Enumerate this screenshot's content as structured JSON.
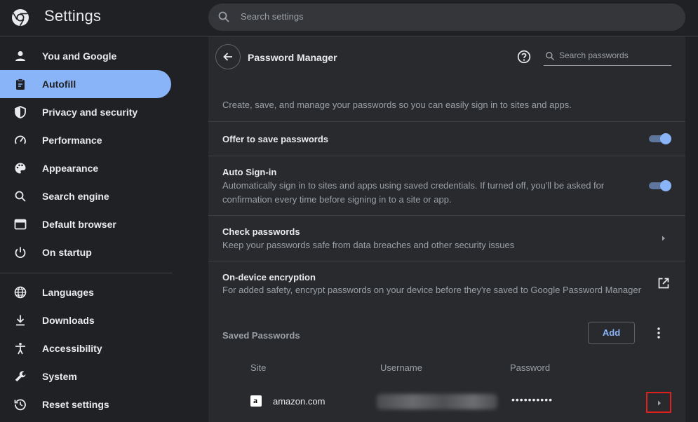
{
  "app": {
    "title": "Settings",
    "search_placeholder": "Search settings"
  },
  "sidebar": {
    "items": [
      {
        "label": "You and Google",
        "icon": "person-icon",
        "active": false
      },
      {
        "label": "Autofill",
        "icon": "clipboard-icon",
        "active": true
      },
      {
        "label": "Privacy and security",
        "icon": "shield-icon",
        "active": false
      },
      {
        "label": "Performance",
        "icon": "speedometer-icon",
        "active": false
      },
      {
        "label": "Appearance",
        "icon": "palette-icon",
        "active": false
      },
      {
        "label": "Search engine",
        "icon": "search-icon",
        "active": false
      },
      {
        "label": "Default browser",
        "icon": "browser-window-icon",
        "active": false
      },
      {
        "label": "On startup",
        "icon": "power-icon",
        "active": false
      },
      {
        "label": "Languages",
        "icon": "globe-icon",
        "active": false
      },
      {
        "label": "Downloads",
        "icon": "download-icon",
        "active": false
      },
      {
        "label": "Accessibility",
        "icon": "accessibility-icon",
        "active": false
      },
      {
        "label": "System",
        "icon": "wrench-icon",
        "active": false
      },
      {
        "label": "Reset settings",
        "icon": "history-icon",
        "active": false
      }
    ]
  },
  "password_manager": {
    "title": "Password Manager",
    "search_placeholder": "Search passwords",
    "description": "Create, save, and manage your passwords so you can easily sign in to sites and apps.",
    "offer_to_save": {
      "title": "Offer to save passwords",
      "enabled": true
    },
    "auto_signin": {
      "title": "Auto Sign-in",
      "subtitle": "Automatically sign in to sites and apps using saved credentials. If turned off, you'll be asked for confirmation every time before signing in to a site or app.",
      "enabled": true
    },
    "check_passwords": {
      "title": "Check passwords",
      "subtitle": "Keep your passwords safe from data breaches and other security issues"
    },
    "encryption": {
      "title": "On-device encryption",
      "subtitle": "For added safety, encrypt passwords on your device before they're saved to Google Password Manager"
    },
    "saved": {
      "title": "Saved Passwords",
      "add_label": "Add",
      "columns": {
        "site": "Site",
        "username": "Username",
        "password": "Password"
      },
      "rows": [
        {
          "site": "amazon.com",
          "favicon_letter": "a",
          "password_mask": "••••••••••"
        }
      ]
    }
  },
  "colors": {
    "accent": "#8ab4f8",
    "background": "#202124",
    "card": "#292a2d",
    "highlight_box": "#e0201d"
  }
}
